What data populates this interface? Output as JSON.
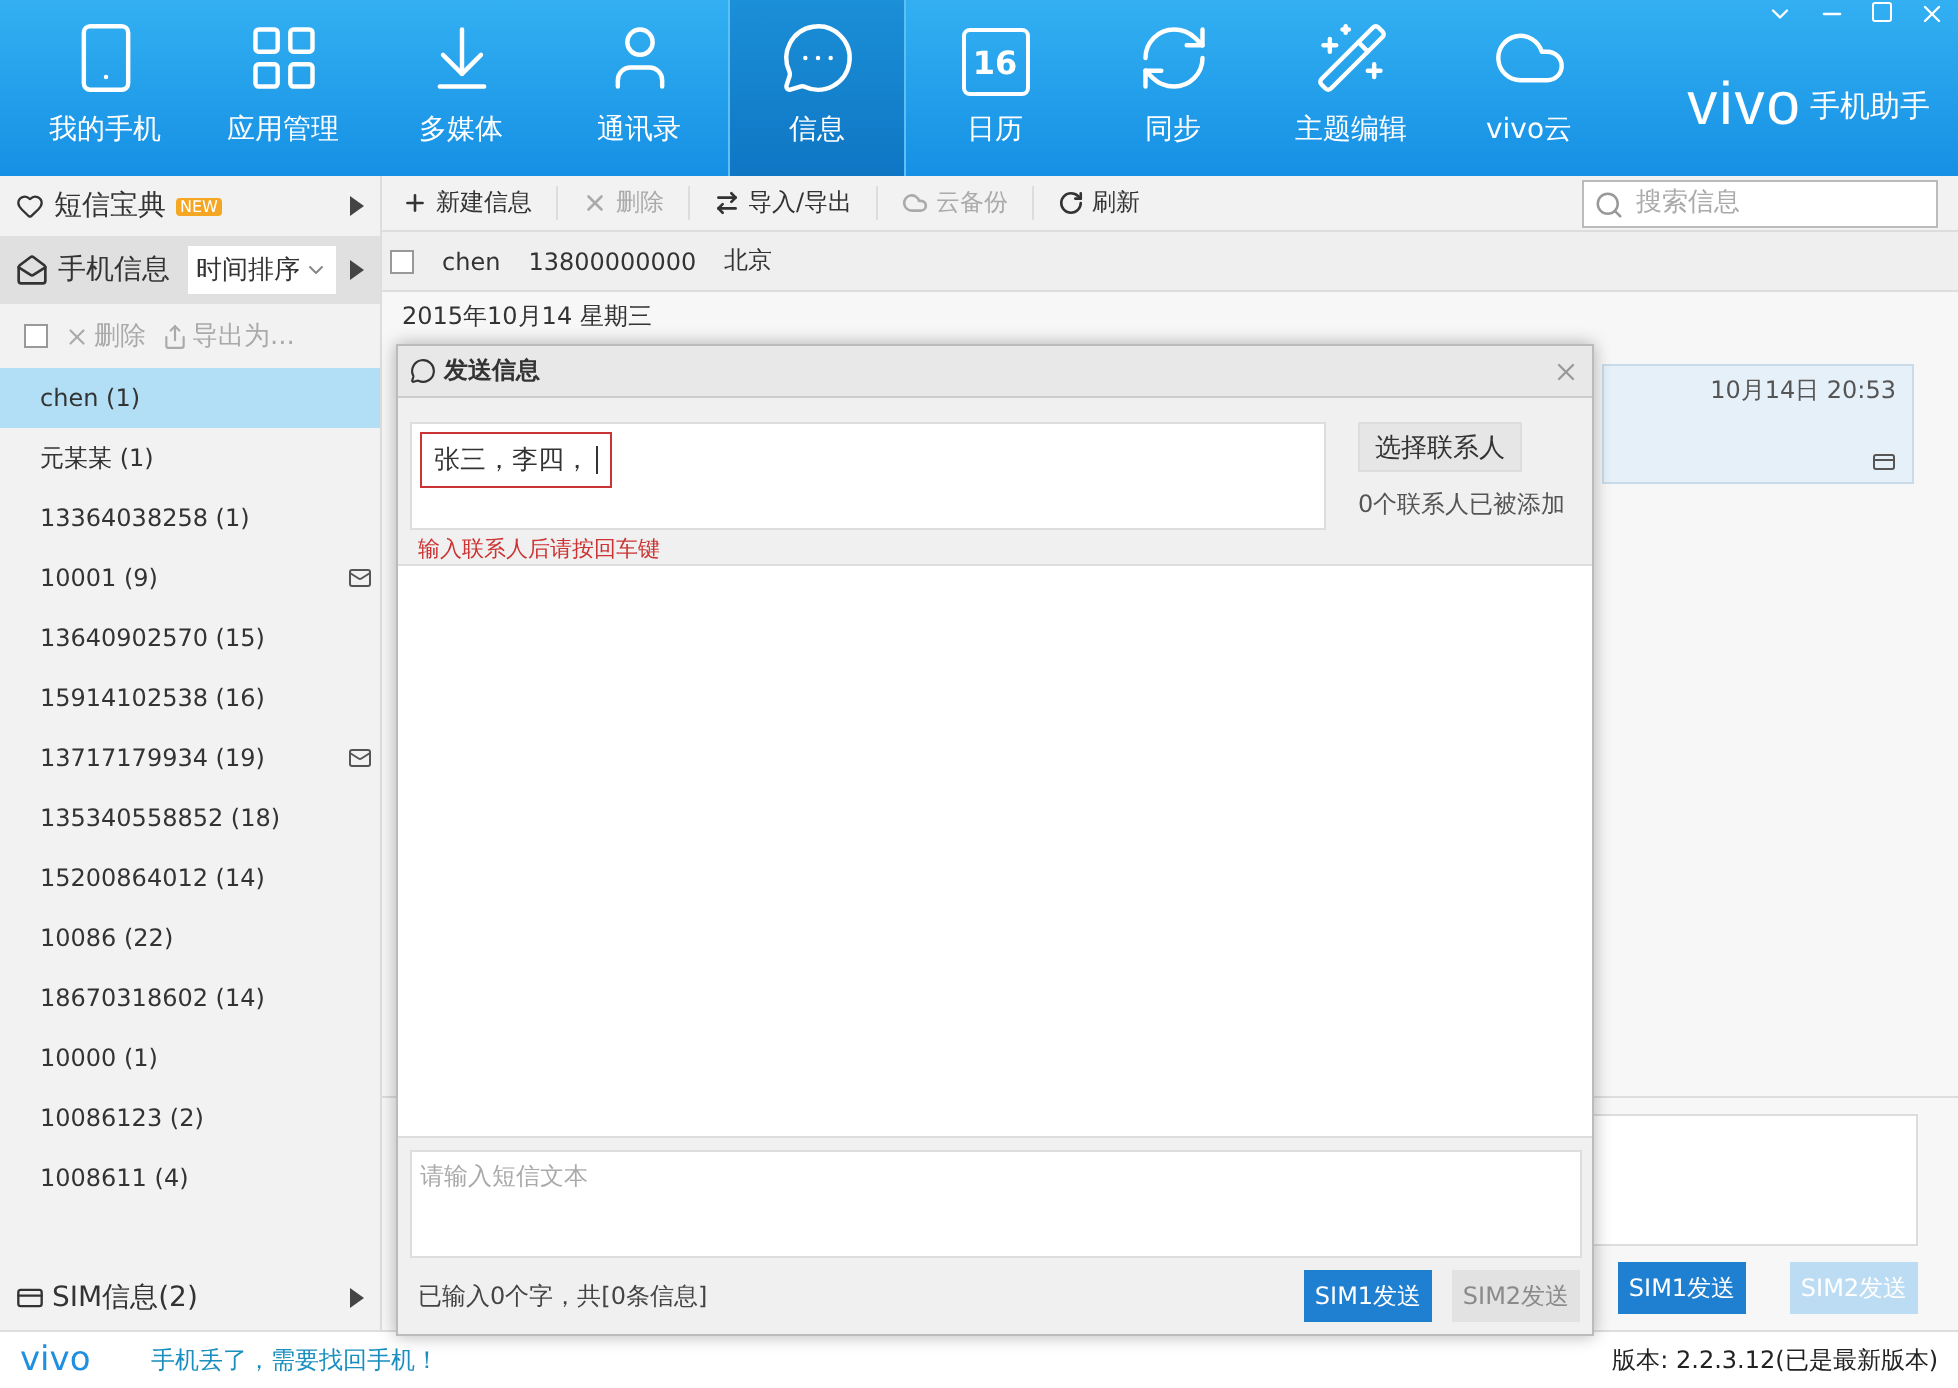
{
  "nav": {
    "items": [
      {
        "label": "我的手机",
        "selected": false
      },
      {
        "label": "应用管理",
        "selected": false
      },
      {
        "label": "多媒体",
        "selected": false
      },
      {
        "label": "通讯录",
        "selected": false
      },
      {
        "label": "信息",
        "selected": true
      },
      {
        "label": "日历",
        "day": "16",
        "selected": false
      },
      {
        "label": "同步",
        "selected": false
      },
      {
        "label": "主题编辑",
        "selected": false
      },
      {
        "label": "vivo云",
        "selected": false
      }
    ]
  },
  "brand": {
    "logo": "vivo",
    "name": "手机助手"
  },
  "sidebar": {
    "featured": {
      "label": "短信宝典",
      "badge": "NEW"
    },
    "phone_section": {
      "label": "手机信息",
      "sort": "时间排序"
    },
    "select_all": {
      "checked": false
    },
    "actions": [
      {
        "label": "删除"
      },
      {
        "label": "导出为..."
      }
    ],
    "conversations": [
      {
        "name": "chen (1)",
        "selected": true,
        "unread": false
      },
      {
        "name": "元某某 (1)",
        "selected": false,
        "unread": false
      },
      {
        "name": "13364038258 (1)",
        "selected": false,
        "unread": false
      },
      {
        "name": "10001 (9)",
        "selected": false,
        "unread": true
      },
      {
        "name": "13640902570 (15)",
        "selected": false,
        "unread": false
      },
      {
        "name": "15914102538 (16)",
        "selected": false,
        "unread": false
      },
      {
        "name": "13717179934 (19)",
        "selected": false,
        "unread": true
      },
      {
        "name": "135340558852 (18)",
        "selected": false,
        "unread": false
      },
      {
        "name": "15200864012 (14)",
        "selected": false,
        "unread": false
      },
      {
        "name": "10086 (22)",
        "selected": false,
        "unread": false
      },
      {
        "name": "18670318602 (14)",
        "selected": false,
        "unread": false
      },
      {
        "name": "10000 (1)",
        "selected": false,
        "unread": false
      },
      {
        "name": "10086123 (2)",
        "selected": false,
        "unread": false
      },
      {
        "name": "1008611 (4)",
        "selected": false,
        "unread": false
      }
    ],
    "sim_section": {
      "label": "SIM信息(2)"
    }
  },
  "toolbar": {
    "actions": [
      {
        "label": "新建信息",
        "disabled": false
      },
      {
        "label": "删除",
        "disabled": true
      },
      {
        "label": "导入/导出",
        "disabled": false
      },
      {
        "label": "云备份",
        "disabled": true
      },
      {
        "label": "刷新",
        "disabled": false
      }
    ],
    "search": {
      "placeholder": "搜索信息"
    }
  },
  "contact": {
    "checked": false,
    "name": "chen",
    "number": "13800000000",
    "location": "北京"
  },
  "date": "2015年10月14 星期三",
  "message": {
    "time": "10月14日 20:53"
  },
  "compose_buttons": [
    {
      "label": "SIM1发送",
      "disabled": false
    },
    {
      "label": "SIM2发送",
      "disabled": true
    }
  ],
  "dialog": {
    "title": "发送信息",
    "recipients": "张三，李四，",
    "hint": "输入联系人后请按回车键",
    "choose_button": "选择联系人",
    "added_count": "0个联系人已被添加",
    "text_placeholder": "请输入短信文本",
    "counter": "已输入0个字，共[0条信息]",
    "buttons": [
      {
        "label": "SIM1发送",
        "disabled": false
      },
      {
        "label": "SIM2发送",
        "disabled": true
      }
    ]
  },
  "footer": {
    "logo": "vivo",
    "link": "手机丢了，需要找回手机！",
    "version": "版本: 2.2.3.12(已是最新版本)"
  }
}
